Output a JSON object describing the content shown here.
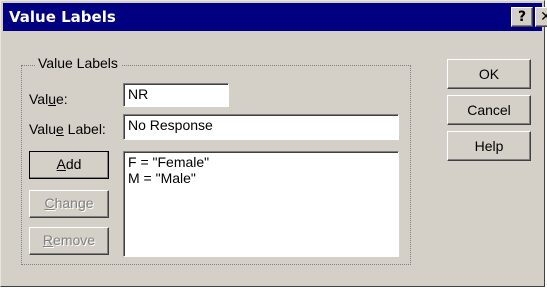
{
  "window": {
    "title": "Value Labels",
    "help_button": "?",
    "close_button": "✕"
  },
  "group": {
    "label": "Value Labels"
  },
  "value_field": {
    "label_pre": "Val",
    "label_mnemonic": "u",
    "label_post": "e:",
    "value": "NR"
  },
  "value_label_field": {
    "label_pre": "Valu",
    "label_mnemonic": "e",
    "label_post": " Label:",
    "value": "No Response"
  },
  "buttons": {
    "add": {
      "mnemonic": "A",
      "rest": "dd"
    },
    "change": {
      "mnemonic": "C",
      "rest": "hange"
    },
    "remove": {
      "mnemonic": "R",
      "rest": "emove"
    },
    "ok": "OK",
    "cancel": "Cancel",
    "help": "Help"
  },
  "labels_list": [
    "F = \"Female\"",
    "M = \"Male\""
  ]
}
